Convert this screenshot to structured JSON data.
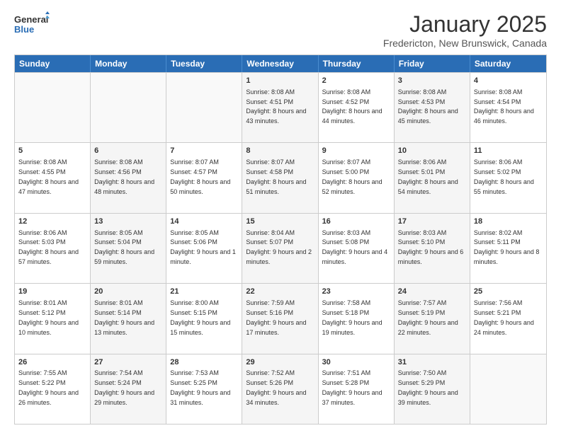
{
  "header": {
    "logo_general": "General",
    "logo_blue": "Blue",
    "title": "January 2025",
    "subtitle": "Fredericton, New Brunswick, Canada"
  },
  "days": [
    "Sunday",
    "Monday",
    "Tuesday",
    "Wednesday",
    "Thursday",
    "Friday",
    "Saturday"
  ],
  "rows": [
    [
      {
        "day": "",
        "empty": true
      },
      {
        "day": "",
        "empty": true
      },
      {
        "day": "",
        "empty": true
      },
      {
        "day": "1",
        "sunrise": "8:08 AM",
        "sunset": "4:51 PM",
        "daylight": "8 hours and 43 minutes."
      },
      {
        "day": "2",
        "sunrise": "8:08 AM",
        "sunset": "4:52 PM",
        "daylight": "8 hours and 44 minutes."
      },
      {
        "day": "3",
        "sunrise": "8:08 AM",
        "sunset": "4:53 PM",
        "daylight": "8 hours and 45 minutes."
      },
      {
        "day": "4",
        "sunrise": "8:08 AM",
        "sunset": "4:54 PM",
        "daylight": "8 hours and 46 minutes."
      }
    ],
    [
      {
        "day": "5",
        "sunrise": "8:08 AM",
        "sunset": "4:55 PM",
        "daylight": "8 hours and 47 minutes."
      },
      {
        "day": "6",
        "sunrise": "8:08 AM",
        "sunset": "4:56 PM",
        "daylight": "8 hours and 48 minutes."
      },
      {
        "day": "7",
        "sunrise": "8:07 AM",
        "sunset": "4:57 PM",
        "daylight": "8 hours and 50 minutes."
      },
      {
        "day": "8",
        "sunrise": "8:07 AM",
        "sunset": "4:58 PM",
        "daylight": "8 hours and 51 minutes."
      },
      {
        "day": "9",
        "sunrise": "8:07 AM",
        "sunset": "5:00 PM",
        "daylight": "8 hours and 52 minutes."
      },
      {
        "day": "10",
        "sunrise": "8:06 AM",
        "sunset": "5:01 PM",
        "daylight": "8 hours and 54 minutes."
      },
      {
        "day": "11",
        "sunrise": "8:06 AM",
        "sunset": "5:02 PM",
        "daylight": "8 hours and 55 minutes."
      }
    ],
    [
      {
        "day": "12",
        "sunrise": "8:06 AM",
        "sunset": "5:03 PM",
        "daylight": "8 hours and 57 minutes."
      },
      {
        "day": "13",
        "sunrise": "8:05 AM",
        "sunset": "5:04 PM",
        "daylight": "8 hours and 59 minutes."
      },
      {
        "day": "14",
        "sunrise": "8:05 AM",
        "sunset": "5:06 PM",
        "daylight": "9 hours and 1 minute."
      },
      {
        "day": "15",
        "sunrise": "8:04 AM",
        "sunset": "5:07 PM",
        "daylight": "9 hours and 2 minutes."
      },
      {
        "day": "16",
        "sunrise": "8:03 AM",
        "sunset": "5:08 PM",
        "daylight": "9 hours and 4 minutes."
      },
      {
        "day": "17",
        "sunrise": "8:03 AM",
        "sunset": "5:10 PM",
        "daylight": "9 hours and 6 minutes."
      },
      {
        "day": "18",
        "sunrise": "8:02 AM",
        "sunset": "5:11 PM",
        "daylight": "9 hours and 8 minutes."
      }
    ],
    [
      {
        "day": "19",
        "sunrise": "8:01 AM",
        "sunset": "5:12 PM",
        "daylight": "9 hours and 10 minutes."
      },
      {
        "day": "20",
        "sunrise": "8:01 AM",
        "sunset": "5:14 PM",
        "daylight": "9 hours and 13 minutes."
      },
      {
        "day": "21",
        "sunrise": "8:00 AM",
        "sunset": "5:15 PM",
        "daylight": "9 hours and 15 minutes."
      },
      {
        "day": "22",
        "sunrise": "7:59 AM",
        "sunset": "5:16 PM",
        "daylight": "9 hours and 17 minutes."
      },
      {
        "day": "23",
        "sunrise": "7:58 AM",
        "sunset": "5:18 PM",
        "daylight": "9 hours and 19 minutes."
      },
      {
        "day": "24",
        "sunrise": "7:57 AM",
        "sunset": "5:19 PM",
        "daylight": "9 hours and 22 minutes."
      },
      {
        "day": "25",
        "sunrise": "7:56 AM",
        "sunset": "5:21 PM",
        "daylight": "9 hours and 24 minutes."
      }
    ],
    [
      {
        "day": "26",
        "sunrise": "7:55 AM",
        "sunset": "5:22 PM",
        "daylight": "9 hours and 26 minutes."
      },
      {
        "day": "27",
        "sunrise": "7:54 AM",
        "sunset": "5:24 PM",
        "daylight": "9 hours and 29 minutes."
      },
      {
        "day": "28",
        "sunrise": "7:53 AM",
        "sunset": "5:25 PM",
        "daylight": "9 hours and 31 minutes."
      },
      {
        "day": "29",
        "sunrise": "7:52 AM",
        "sunset": "5:26 PM",
        "daylight": "9 hours and 34 minutes."
      },
      {
        "day": "30",
        "sunrise": "7:51 AM",
        "sunset": "5:28 PM",
        "daylight": "9 hours and 37 minutes."
      },
      {
        "day": "31",
        "sunrise": "7:50 AM",
        "sunset": "5:29 PM",
        "daylight": "9 hours and 39 minutes."
      },
      {
        "day": "",
        "empty": true
      }
    ]
  ],
  "labels": {
    "sunrise": "Sunrise:",
    "sunset": "Sunset:",
    "daylight": "Daylight:"
  }
}
